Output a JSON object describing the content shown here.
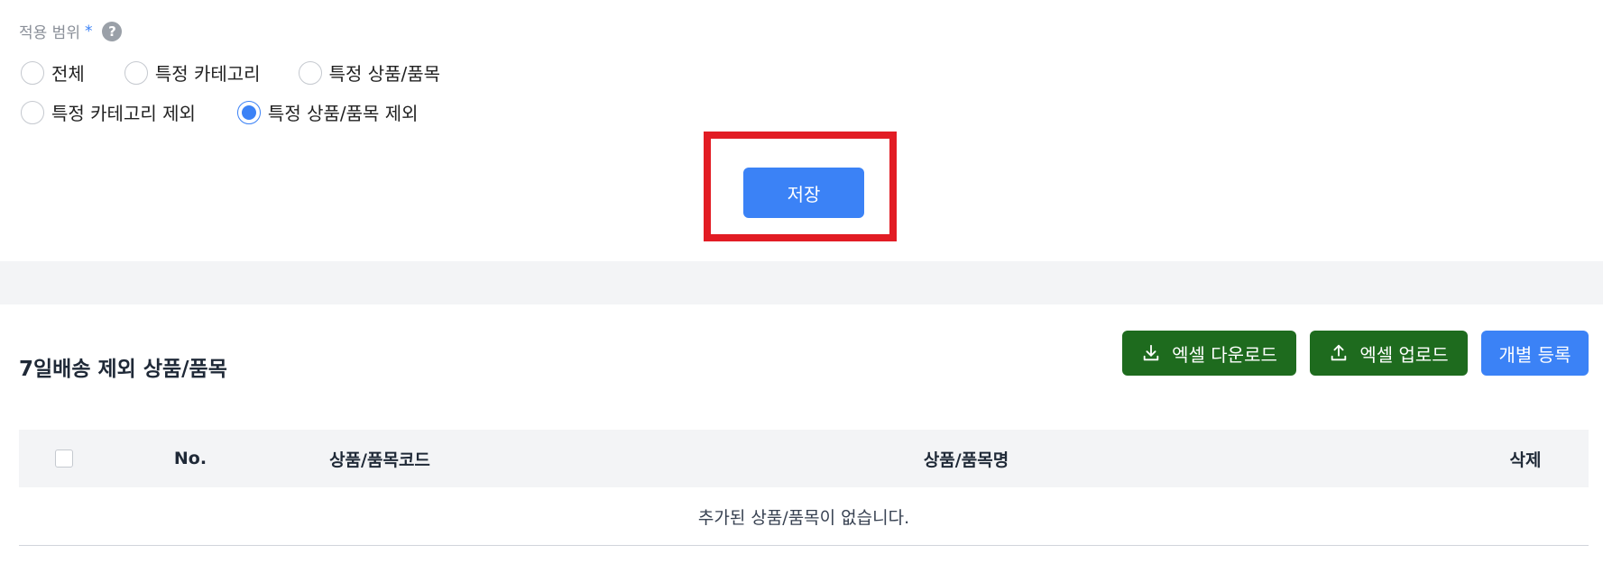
{
  "scope": {
    "label": "적용 범위",
    "required_mark": "*",
    "help_icon": "?",
    "options": [
      {
        "label": "전체",
        "checked": false
      },
      {
        "label": "특정 카테고리",
        "checked": false
      },
      {
        "label": "특정 상품/품목",
        "checked": false
      },
      {
        "label": "특정 카테고리 제외",
        "checked": false
      },
      {
        "label": "특정 상품/품목 제외",
        "checked": true
      }
    ]
  },
  "save_button": "저장",
  "list": {
    "title": "7일배송 제외 상품/품목",
    "buttons": {
      "excel_download": "엑셀 다운로드",
      "excel_upload": "엑셀 업로드",
      "individual_register": "개별 등록"
    },
    "columns": {
      "no": "No.",
      "code": "상품/품목코드",
      "name": "상품/품목명",
      "delete": "삭제"
    },
    "empty_message": "추가된 상품/품목이 없습니다."
  },
  "colors": {
    "primary": "#3b82f6",
    "excel_green": "#1e6b1e",
    "highlight_red": "#e21c24",
    "band_gray": "#f3f4f6"
  },
  "icons": {
    "download": "download-icon",
    "upload": "upload-icon",
    "help": "help-icon"
  }
}
